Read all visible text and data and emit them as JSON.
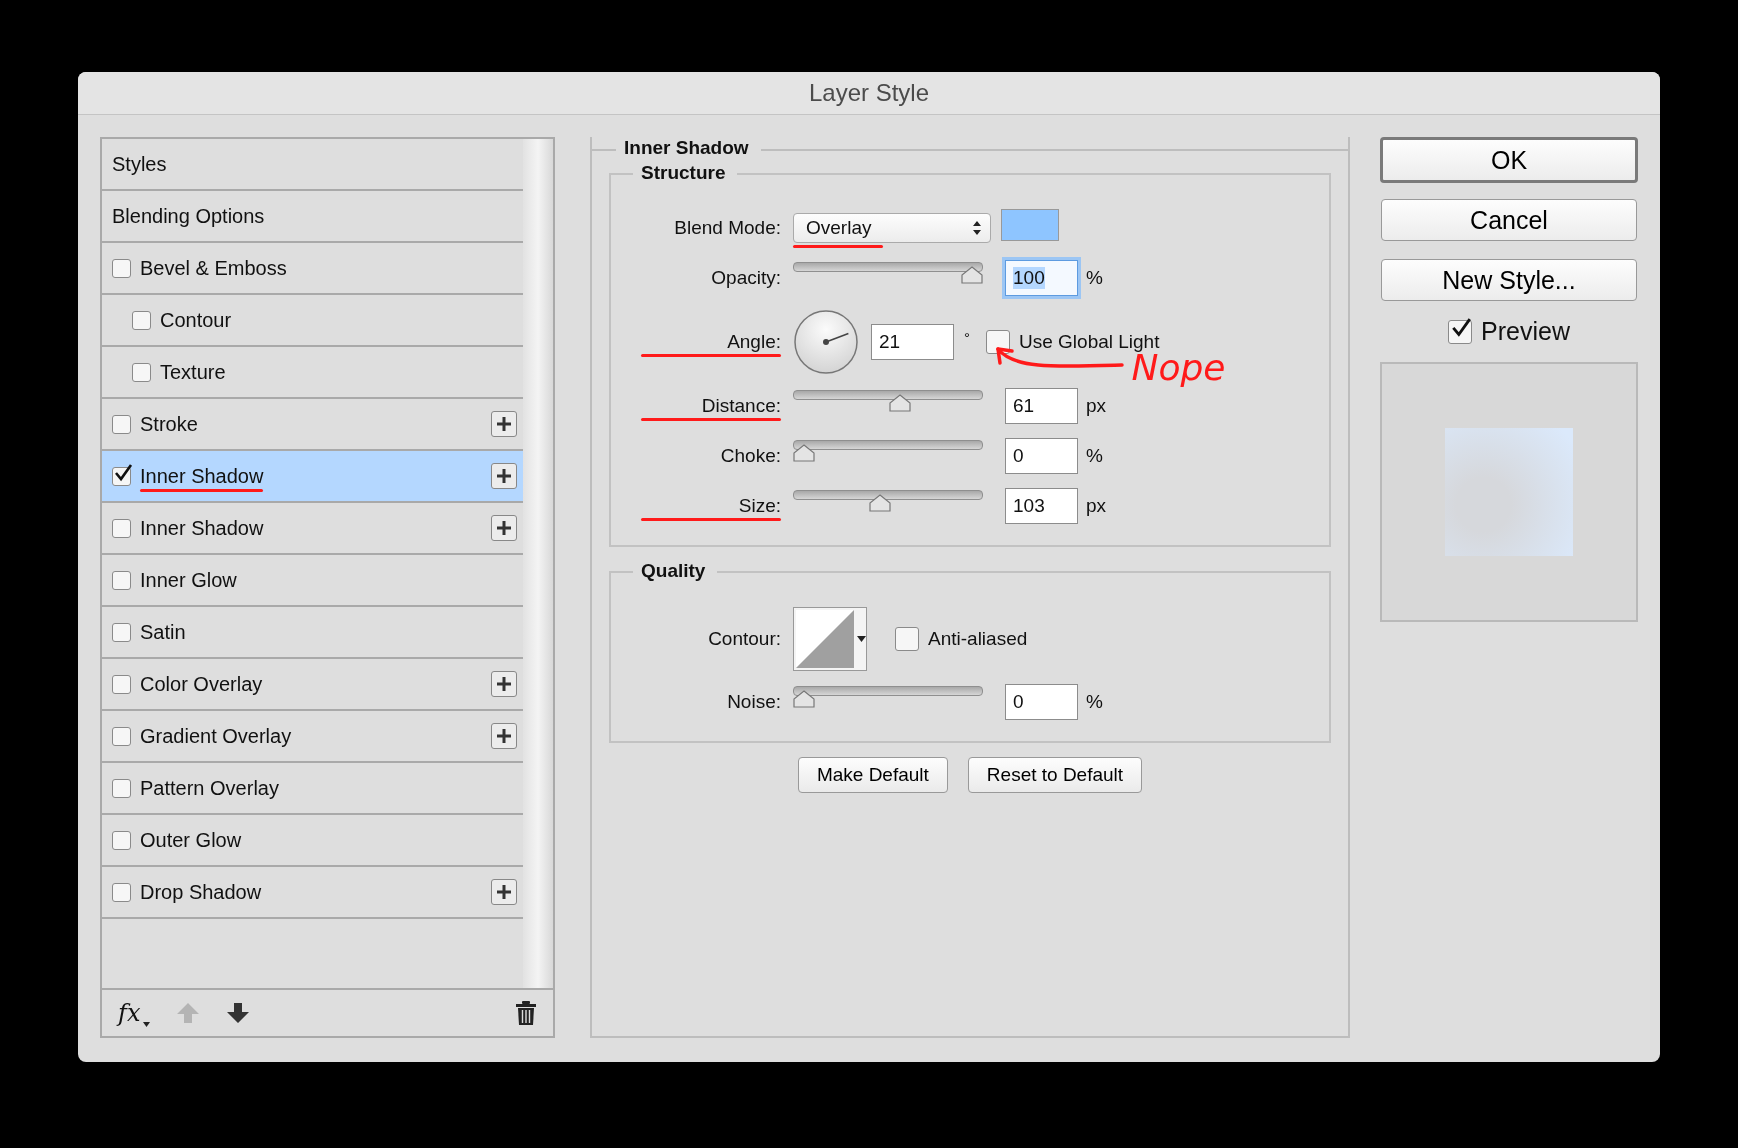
{
  "window": {
    "title": "Layer Style"
  },
  "styles_list": {
    "items": [
      {
        "kind": "heading",
        "label": "Styles",
        "selected": false
      },
      {
        "kind": "heading",
        "label": "Blending Options",
        "selected": false
      },
      {
        "kind": "effect",
        "label": "Bevel & Emboss",
        "checked": false,
        "selected": false,
        "addable": false,
        "annotated": false
      },
      {
        "kind": "sub_effect",
        "label": "Contour",
        "checked": false,
        "selected": false,
        "addable": false,
        "annotated": false
      },
      {
        "kind": "sub_effect",
        "label": "Texture",
        "checked": false,
        "selected": false,
        "addable": false,
        "annotated": false
      },
      {
        "kind": "effect",
        "label": "Stroke",
        "checked": false,
        "selected": false,
        "addable": true,
        "annotated": false
      },
      {
        "kind": "effect",
        "label": "Inner Shadow",
        "checked": true,
        "selected": true,
        "addable": true,
        "annotated": true
      },
      {
        "kind": "effect",
        "label": "Inner Shadow",
        "checked": false,
        "selected": false,
        "addable": true,
        "annotated": false
      },
      {
        "kind": "effect",
        "label": "Inner Glow",
        "checked": false,
        "selected": false,
        "addable": false,
        "annotated": false
      },
      {
        "kind": "effect",
        "label": "Satin",
        "checked": false,
        "selected": false,
        "addable": false,
        "annotated": false
      },
      {
        "kind": "effect",
        "label": "Color Overlay",
        "checked": false,
        "selected": false,
        "addable": true,
        "annotated": false
      },
      {
        "kind": "effect",
        "label": "Gradient Overlay",
        "checked": false,
        "selected": false,
        "addable": true,
        "annotated": false
      },
      {
        "kind": "effect",
        "label": "Pattern Overlay",
        "checked": false,
        "selected": false,
        "addable": false,
        "annotated": false
      },
      {
        "kind": "effect",
        "label": "Outer Glow",
        "checked": false,
        "selected": false,
        "addable": false,
        "annotated": false
      },
      {
        "kind": "effect",
        "label": "Drop Shadow",
        "checked": false,
        "selected": false,
        "addable": true,
        "annotated": false
      }
    ]
  },
  "toolbar": [
    {
      "kind": "fx",
      "label": "fx"
    },
    {
      "kind": "move_up",
      "disabled": true
    },
    {
      "kind": "move_down",
      "disabled": false
    },
    {
      "kind": "delete",
      "disabled": false
    }
  ],
  "panel": {
    "title": "Inner Shadow",
    "groups": [
      {
        "title": "Structure",
        "rows": [
          {
            "kind": "select",
            "label": "Blend Mode:",
            "value": "Overlay",
            "color": "#8ec5ff",
            "label_annotated": false,
            "value_annotated": true
          },
          {
            "kind": "slider",
            "label": "Opacity:",
            "level": 1.0,
            "value": "100",
            "unit": "%",
            "value_selected": true,
            "label_annotated": false
          },
          {
            "kind": "angle",
            "label": "Angle:",
            "value": "21",
            "unit": "°",
            "checkbox_label": "Use Global Light",
            "checked": false,
            "label_annotated": true,
            "note": "Nope"
          },
          {
            "kind": "slider",
            "label": "Distance:",
            "level": 0.57,
            "value": "61",
            "unit": "px",
            "value_selected": false,
            "label_annotated": true
          },
          {
            "kind": "slider",
            "label": "Choke:",
            "level": 0,
            "value": "0",
            "unit": "%",
            "value_selected": false,
            "label_annotated": false
          },
          {
            "kind": "slider",
            "label": "Size:",
            "level": 0.45,
            "value": "103",
            "unit": "px",
            "value_selected": false,
            "label_annotated": true
          }
        ]
      },
      {
        "title": "Quality",
        "rows": [
          {
            "kind": "contour",
            "label": "Contour:",
            "checkbox_label": "Anti-aliased",
            "checked": false,
            "label_annotated": false
          },
          {
            "kind": "slider",
            "label": "Noise:",
            "level": 0,
            "value": "0",
            "unit": "%",
            "value_selected": false,
            "label_annotated": false
          }
        ]
      }
    ],
    "buttons": [
      "Make Default",
      "Reset to Default"
    ]
  },
  "actions": [
    {
      "label": "OK",
      "default": true
    },
    {
      "label": "Cancel",
      "default": false
    },
    {
      "label": "New Style...",
      "default": false
    }
  ],
  "preview": {
    "label": "Preview",
    "checked": true
  }
}
